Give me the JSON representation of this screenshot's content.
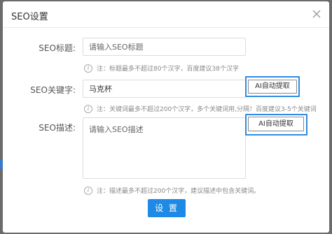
{
  "dialog": {
    "title": "SEO设置",
    "close_icon": "close-icon"
  },
  "form": {
    "title_field": {
      "label": "SEO标题:",
      "placeholder": "请输入SEO标题",
      "value": "",
      "hint": "注：标题最多不超过80个汉字，百度建议38个汉字"
    },
    "keywords_field": {
      "label": "SEO关键字:",
      "value": "马克杯",
      "button_label": "AI自动提取",
      "hint": "注：关键词最多不超过200个汉字，多个关键词用,分隔！百度建议3-5个关键词"
    },
    "description_field": {
      "label": "SEO描述:",
      "placeholder": "请输入SEO描述",
      "value": "",
      "button_label": "AI自动提取",
      "hint": "注：描述最多不超过200个汉字，建议描述中包含关键词。"
    }
  },
  "actions": {
    "submit_label": "设 置"
  },
  "colors": {
    "accent": "#1e8ae5",
    "highlight": "#2f8be0",
    "overlay": "#6b6b6b"
  }
}
